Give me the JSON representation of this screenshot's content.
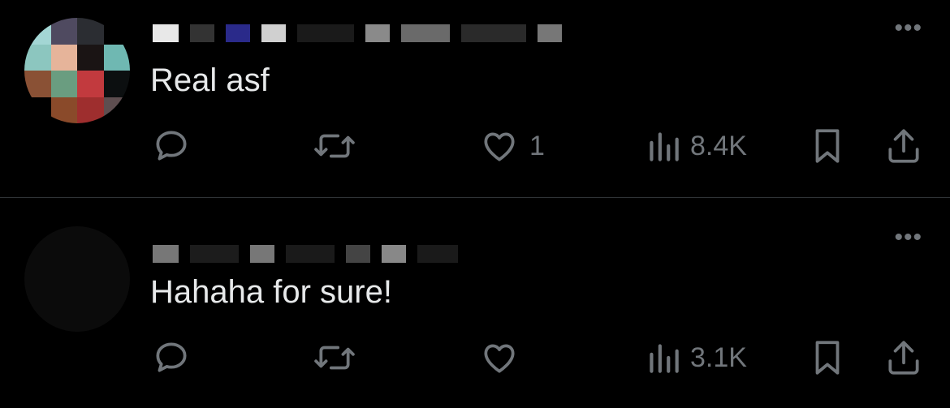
{
  "tweets": [
    {
      "text": "Real asf",
      "reply_count": "",
      "retweet_count": "",
      "like_count": "1",
      "views": "8.4K",
      "avatar": "pixelated"
    },
    {
      "text": "Hahaha for sure!",
      "reply_count": "",
      "retweet_count": "",
      "like_count": "",
      "views": "3.1K",
      "avatar": "dark"
    }
  ],
  "more_glyph": "•••",
  "icons": {
    "reply": "reply-icon",
    "retweet": "retweet-icon",
    "like": "heart-icon",
    "views": "bar-chart-icon",
    "bookmark": "bookmark-icon",
    "share": "share-icon"
  },
  "colors": {
    "background": "#000000",
    "text": "#e7e9ea",
    "muted": "#71767b",
    "divider": "#2f3336"
  }
}
